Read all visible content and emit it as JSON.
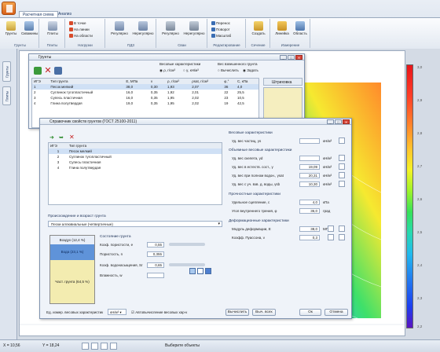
{
  "ribbon": {
    "tabs": [
      "Расчетная схема",
      "Анализ"
    ],
    "groups": [
      {
        "label": "Грунты",
        "big": [
          "Грунты",
          "Скважины"
        ]
      },
      {
        "label": "Плиты",
        "big": [
          "Плиты"
        ]
      },
      {
        "label": "Нагрузки",
        "small": [
          "В точке",
          "На линии",
          "На области"
        ]
      },
      {
        "label": "ПДЗ",
        "big": [
          "Регулярно",
          "Нерегулярно"
        ]
      },
      {
        "label": "Сваи",
        "big": [
          "Регулярно",
          "Нерегулярно"
        ]
      },
      {
        "label": "Редактирование",
        "small": [
          "Перенос",
          "Поворот",
          "Масштаб"
        ]
      },
      {
        "label": "Сечение",
        "big": [
          "Создать"
        ]
      },
      {
        "label": "Измерение",
        "big": [
          "Линейка",
          "Область"
        ]
      }
    ]
  },
  "left_tabs": [
    "Грунты",
    "Плиты"
  ],
  "colorbar": {
    "labels": [
      "3,0",
      "2,9",
      "2,8",
      "2,7",
      "2,6",
      "2,5",
      "2,4",
      "2,3",
      "2,2"
    ]
  },
  "status": {
    "x_label": "X = 10,56",
    "y_label": "Y = 18,24",
    "message": "Выберите объекты"
  },
  "soils_window": {
    "title": "Грунты",
    "weight_label": "Весовые характеристики",
    "weight_opts": [
      "ρ, г/см³",
      "γ, кН/м³"
    ],
    "suspended_label": "Вес взвешенного грунта",
    "suspended_opts": [
      "Вычислить",
      "Задать"
    ],
    "hatch_label": "Штриховка",
    "columns": [
      "ИГЭ",
      "Тип грунта",
      "E, МПа",
      "ν",
      "ρ, г/см³",
      "ρsat, г/см³",
      "φ,°",
      "C, кПа"
    ],
    "rows": [
      [
        "1",
        "Песок мелкий",
        "38,0",
        "0,30",
        "1,93",
        "2,07",
        "36",
        "4,0"
      ],
      [
        "2",
        "Суглинок тугопластичный",
        "16,0",
        "0,35",
        "1,92",
        "2,01",
        "22",
        "25,5"
      ],
      [
        "3",
        "Супесь пластичная",
        "16,0",
        "0,35",
        "1,95",
        "2,02",
        "23",
        "10,5"
      ],
      [
        "4",
        "Глина полутвердая",
        "19,0",
        "0,35",
        "1,95",
        "2,02",
        "19",
        "42,5"
      ]
    ]
  },
  "props_window": {
    "title": "Справочник свойств грунтов (ГОСТ 25100-2011)",
    "list_columns": [
      "ИГЭ",
      "Тип грунта"
    ],
    "list_rows": [
      [
        "1",
        "Песок мелкий"
      ],
      [
        "2",
        "Суглинок тугопластичный"
      ],
      [
        "3",
        "Супесь пластичная"
      ],
      [
        "4",
        "Глина полутвердая"
      ]
    ],
    "origin_label": "Происхождение и возраст грунта",
    "origin_value": "Пески аллювиальные (четвертичные)",
    "phases": {
      "air": "Воздух (12,4 %)",
      "water": "Вода (23,1 %)",
      "solid": "Част. грунта (64,5 %)"
    },
    "composition": {
      "title": "Состояние грунта",
      "fields": [
        [
          "Коэф. пористости, е",
          "0,55"
        ],
        [
          "Пористость, n",
          "0,355"
        ],
        [
          "Коэф. водонасыщения, Sr",
          "0,65"
        ],
        [
          "Влажность, w",
          ""
        ]
      ]
    },
    "units_label": "Ед. измер. весовых характеристик",
    "units_value": "кН/м³",
    "auto_label": "Автовычисление весовых хар-к",
    "weight_section": "Весовые характеристики",
    "weight_fields": [
      [
        "Уд. вес частиц, γs",
        "",
        "кН/м³"
      ]
    ],
    "volume_section": "Объемные весовые характеристики",
    "volume_fields": [
      [
        "Уд. вес скелета, γd",
        "",
        "кН/м³"
      ],
      [
        "Уд. вес в естеств. сост., γ",
        "19,09",
        "кН/м³"
      ],
      [
        "Уд. вес при полном водон., γsat",
        "20,31",
        "кН/м³"
      ],
      [
        "Уд. вес с уч. взв. д. воды, γsb",
        "10,30",
        "кН/м³"
      ]
    ],
    "strength_section": "Прочностные характеристики",
    "strength_fields": [
      [
        "Удельное сцепление, с",
        "4,0",
        "кПа"
      ],
      [
        "Угол внутреннего трения, φ",
        "36,0",
        "град"
      ]
    ],
    "deform_section": "Деформационные характеристики",
    "deform_fields": [
      [
        "Модуль деформации, Е",
        "38,0",
        "МПа"
      ],
      [
        "Коэфф. Пуассона, ν",
        "0,3",
        ""
      ]
    ],
    "buttons": {
      "calc": "Вычислить",
      "choose": "Выч. всех",
      "ok": "Ок",
      "cancel": "Отмена"
    }
  }
}
